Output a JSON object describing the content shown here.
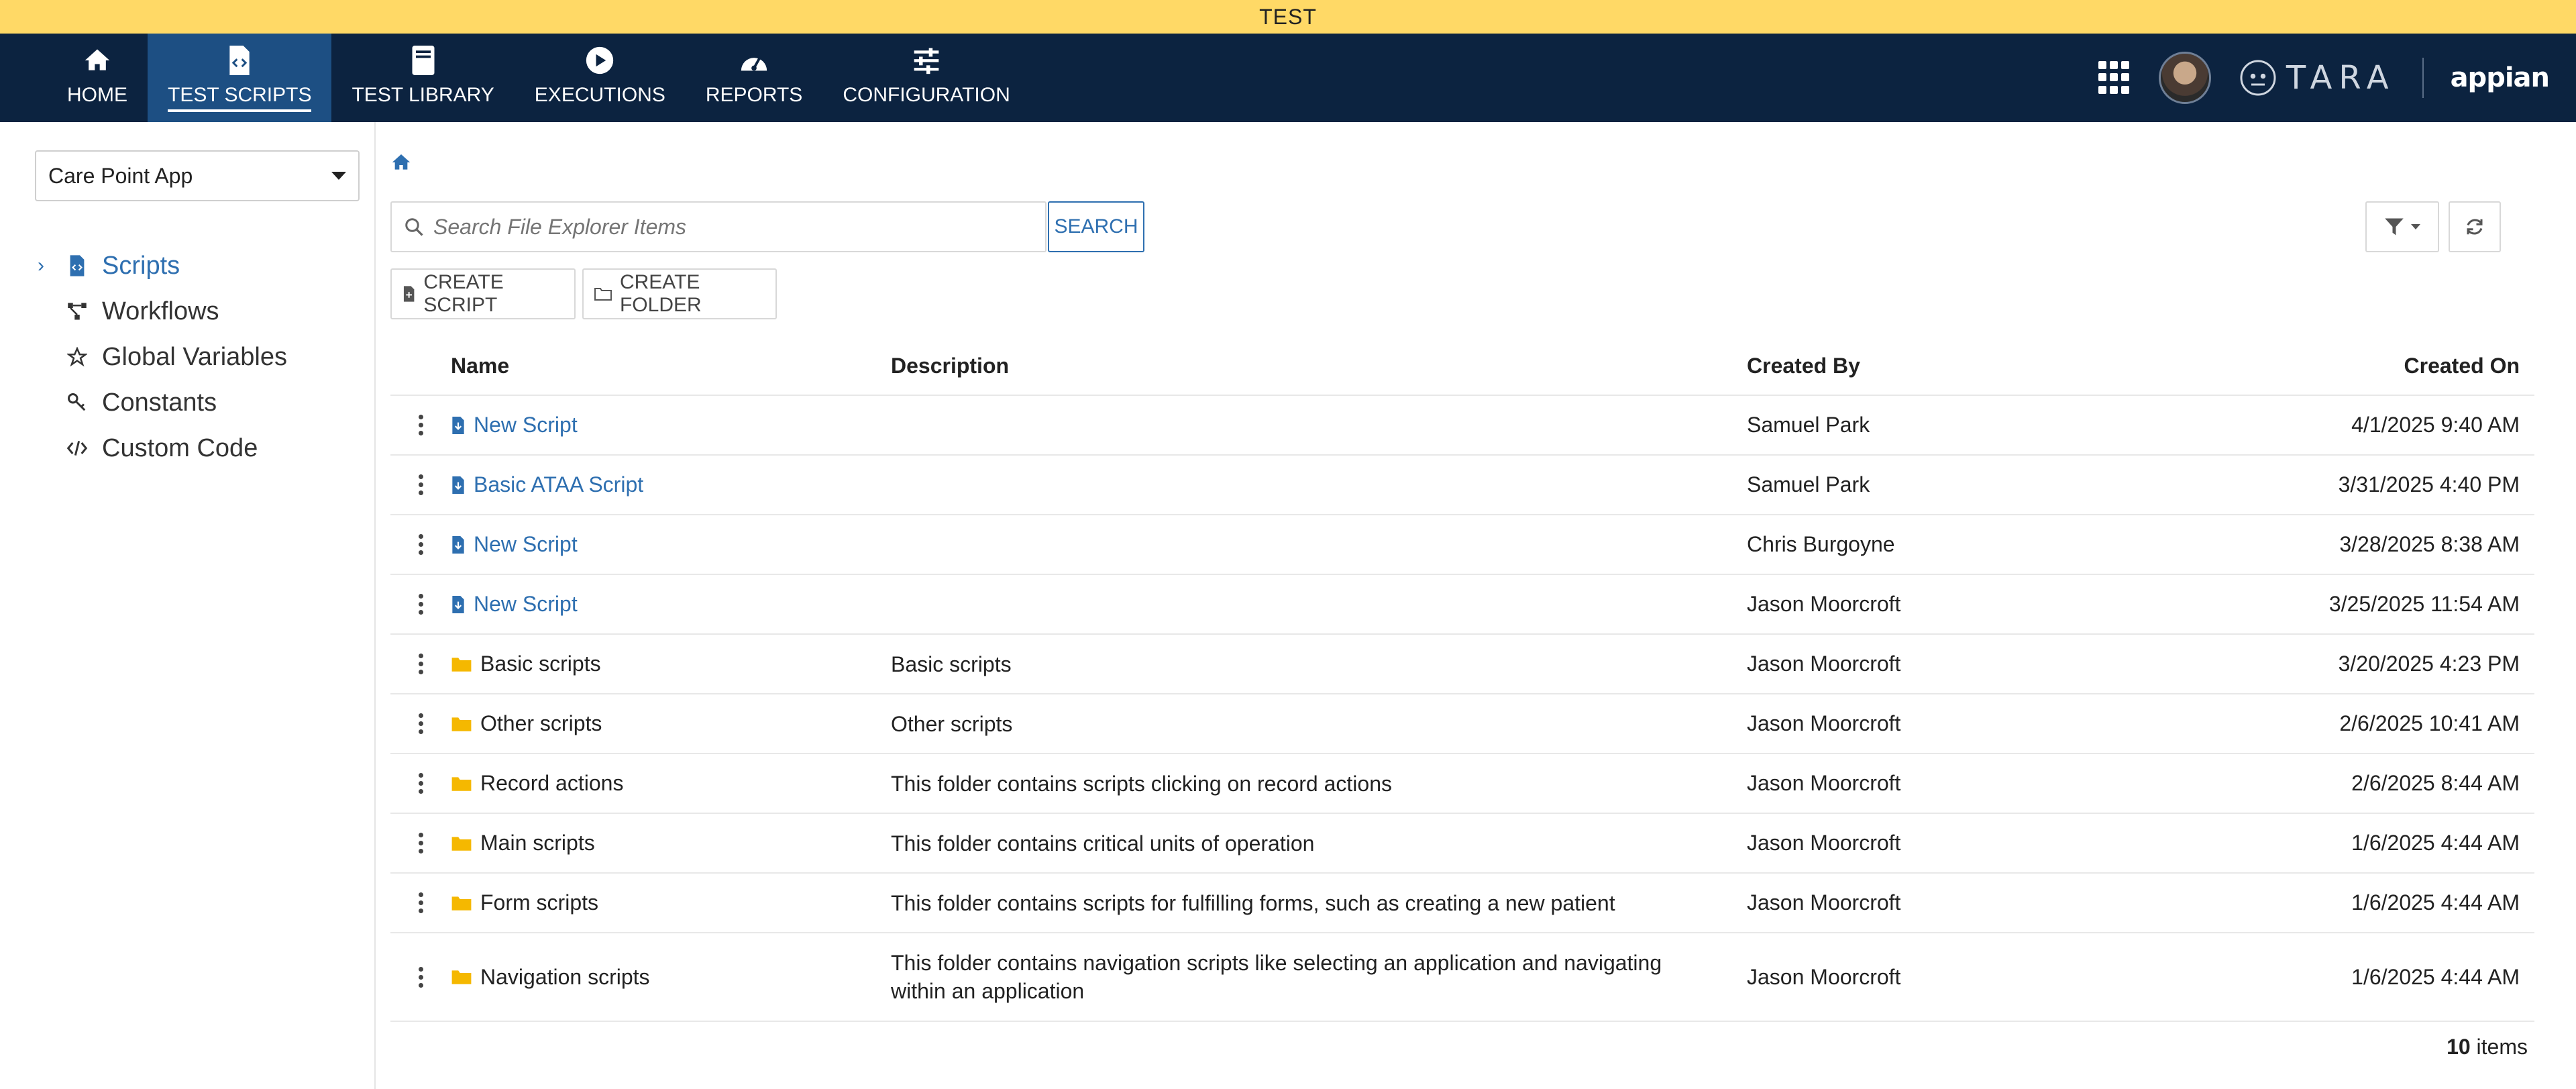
{
  "env": {
    "label": "TEST"
  },
  "nav": {
    "items": [
      {
        "label": "HOME",
        "icon": "home-icon"
      },
      {
        "label": "TEST SCRIPTS",
        "icon": "script-file-icon",
        "active": true
      },
      {
        "label": "TEST LIBRARY",
        "icon": "book-icon"
      },
      {
        "label": "EXECUTIONS",
        "icon": "play-icon"
      },
      {
        "label": "REPORTS",
        "icon": "gauge-icon"
      },
      {
        "label": "CONFIGURATION",
        "icon": "sliders-icon"
      }
    ],
    "brand": {
      "tara": "TARA",
      "appian": "appian"
    }
  },
  "sidebar": {
    "app_select": "Care Point App",
    "items": [
      {
        "label": "Scripts",
        "icon": "script-file-icon",
        "active": true
      },
      {
        "label": "Workflows",
        "icon": "workflow-icon"
      },
      {
        "label": "Global Variables",
        "icon": "star-icon"
      },
      {
        "label": "Constants",
        "icon": "key-icon"
      },
      {
        "label": "Custom Code",
        "icon": "code-icon"
      }
    ]
  },
  "main": {
    "search_placeholder": "Search File Explorer Items",
    "search_button": "SEARCH",
    "create_script": "CREATE SCRIPT",
    "create_folder": "CREATE FOLDER",
    "columns": {
      "name": "Name",
      "description": "Description",
      "created_by": "Created By",
      "created_on": "Created On"
    },
    "rows": [
      {
        "type": "script",
        "name": "New Script",
        "description": "",
        "created_by": "Samuel Park",
        "created_on": "4/1/2025 9:40 AM"
      },
      {
        "type": "script",
        "name": "Basic ATAA Script",
        "description": "",
        "created_by": "Samuel Park",
        "created_on": "3/31/2025 4:40 PM"
      },
      {
        "type": "script",
        "name": "New Script",
        "description": "",
        "created_by": "Chris Burgoyne",
        "created_on": "3/28/2025 8:38 AM"
      },
      {
        "type": "script",
        "name": "New Script",
        "description": "",
        "created_by": "Jason Moorcroft",
        "created_on": "3/25/2025 11:54 AM"
      },
      {
        "type": "folder",
        "name": "Basic scripts",
        "description": "Basic scripts",
        "created_by": "Jason Moorcroft",
        "created_on": "3/20/2025 4:23 PM"
      },
      {
        "type": "folder",
        "name": "Other scripts",
        "description": "Other scripts",
        "created_by": "Jason Moorcroft",
        "created_on": "2/6/2025 10:41 AM"
      },
      {
        "type": "folder",
        "name": "Record actions",
        "description": "This folder contains scripts clicking on record actions",
        "created_by": "Jason Moorcroft",
        "created_on": "2/6/2025 8:44 AM"
      },
      {
        "type": "folder",
        "name": "Main scripts",
        "description": "This folder contains critical units of operation",
        "created_by": "Jason Moorcroft",
        "created_on": "1/6/2025 4:44 AM"
      },
      {
        "type": "folder",
        "name": "Form scripts",
        "description": "This folder contains scripts for fulfilling forms, such as creating a new patient",
        "created_by": "Jason Moorcroft",
        "created_on": "1/6/2025 4:44 AM"
      },
      {
        "type": "folder",
        "name": "Navigation scripts",
        "description": "This folder contains navigation scripts like selecting an application and navigating within an application",
        "created_by": "Jason Moorcroft",
        "created_on": "1/6/2025 4:44 AM"
      }
    ],
    "items_count": "10",
    "items_label": "items"
  },
  "colors": {
    "navbar": "#0c2340",
    "env_bar": "#ffd966",
    "accent": "#2e6fb0",
    "folder": "#f5b800"
  }
}
